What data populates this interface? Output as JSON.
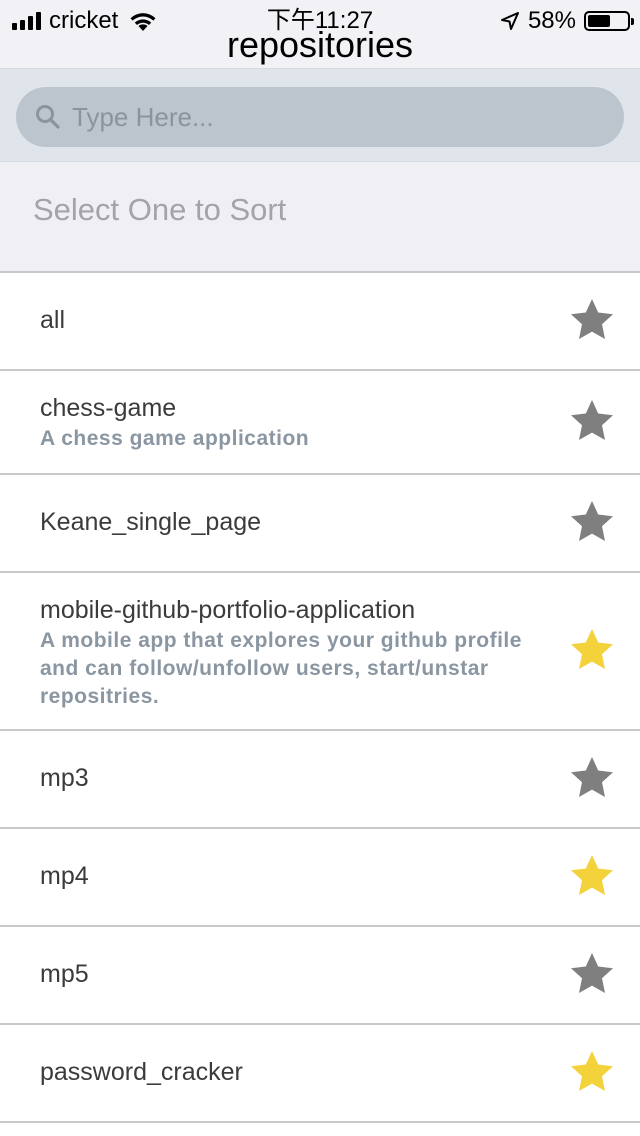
{
  "status_bar": {
    "carrier": "cricket",
    "time": "下午11:27",
    "battery_percent": "58%",
    "battery_level": 0.58
  },
  "nav": {
    "title": "repositories"
  },
  "search": {
    "placeholder": "Type Here...",
    "value": ""
  },
  "sort": {
    "label": "Select One to Sort"
  },
  "colors": {
    "star_on": "#f4d23c",
    "star_off": "#7f7f7f",
    "description": "#8a96a1"
  },
  "repositories": [
    {
      "name": "all",
      "description": "",
      "starred": false
    },
    {
      "name": "chess-game",
      "description": "A chess game application",
      "starred": false
    },
    {
      "name": "Keane_single_page",
      "description": "",
      "starred": false
    },
    {
      "name": "mobile-github-portfolio-application",
      "description": "A mobile app that explores your github profile and can follow/unfollow users, start/unstar repositries.",
      "starred": true
    },
    {
      "name": "mp3",
      "description": "",
      "starred": false
    },
    {
      "name": "mp4",
      "description": "",
      "starred": true
    },
    {
      "name": "mp5",
      "description": "",
      "starred": false
    },
    {
      "name": "password_cracker",
      "description": "",
      "starred": true
    }
  ]
}
